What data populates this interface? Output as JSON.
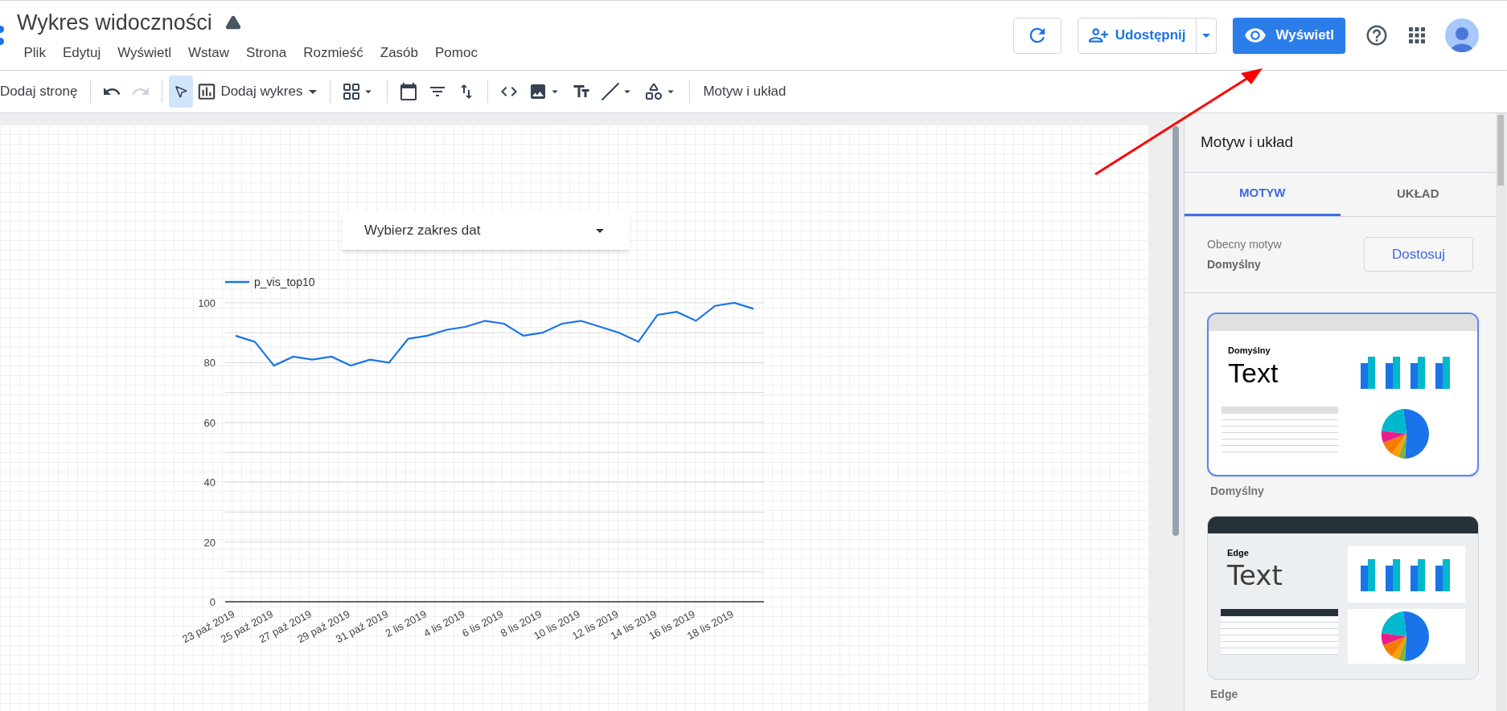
{
  "report": {
    "title": "Wykres widoczności"
  },
  "menu": [
    "Plik",
    "Edytuj",
    "Wyświetl",
    "Wstaw",
    "Strona",
    "Rozmieść",
    "Zasób",
    "Pomoc"
  ],
  "toolbar": {
    "add_page": "Dodaj stronę",
    "add_chart": "Dodaj wykres",
    "theme_layout": "Motyw i układ",
    "select_tool": {
      "selected": true
    }
  },
  "header_buttons": {
    "share": "Udostępnij",
    "view": "Wyświetl"
  },
  "canvas": {
    "date_picker": {
      "label": "Wybierz zakres dat"
    },
    "chart_data": {
      "type": "line",
      "grid": true,
      "ylim": [
        0,
        100
      ],
      "yticks": [
        0,
        20,
        40,
        60,
        80,
        100
      ],
      "categories": [
        "23 paź 2019",
        null,
        "25 paź 2019",
        null,
        "27 paź 2019",
        null,
        "29 paź 2019",
        null,
        "31 paź 2019",
        null,
        "2 lis 2019",
        null,
        "4 lis 2019",
        null,
        "6 lis 2019",
        null,
        "8 lis 2019",
        null,
        "10 lis 2019",
        null,
        "12 lis 2019",
        null,
        "14 lis 2019",
        null,
        "16 lis 2019",
        null,
        "18 lis 2019",
        null
      ],
      "series": [
        {
          "name": "p_vis_top10",
          "color": "#1a73e8",
          "values": [
            89,
            87,
            79,
            82,
            81,
            82,
            79,
            81,
            80,
            88,
            89,
            91,
            92,
            94,
            93,
            89,
            90,
            93,
            94,
            92,
            90,
            87,
            96,
            97,
            94,
            99,
            100,
            98
          ]
        }
      ]
    }
  },
  "panel": {
    "title": "Motyw i układ",
    "tabs": [
      {
        "label": "MOTYW",
        "selected": true
      },
      {
        "label": "UKŁAD",
        "selected": false
      }
    ],
    "current_theme_label": "Obecny motyw",
    "current_theme": "Domyślny",
    "customize": "Dostosuj",
    "themes": [
      {
        "kind": "light",
        "preview_heading": "Domyślny",
        "preview_text": "Text",
        "name": "Domyślny",
        "selected": true
      },
      {
        "kind": "dark",
        "preview_heading": "Edge",
        "preview_text": "Text",
        "name": "Edge",
        "selected": false
      }
    ]
  }
}
